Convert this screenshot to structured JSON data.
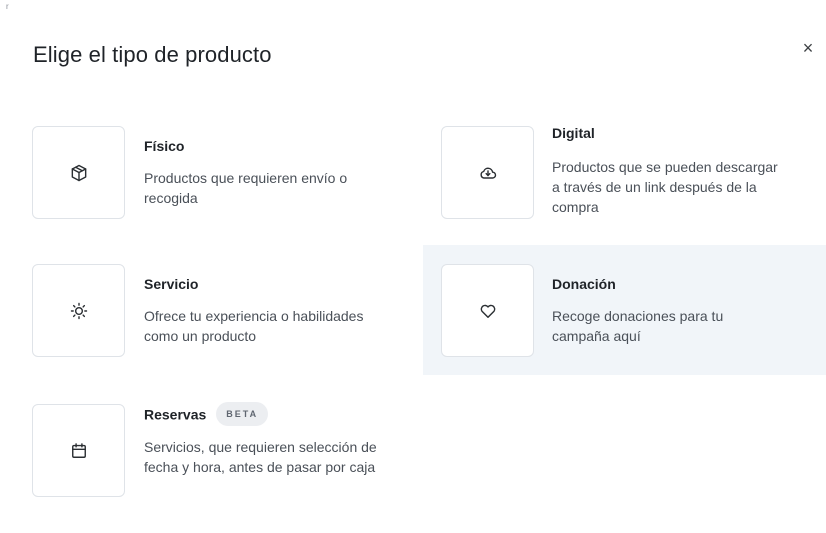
{
  "corner_mark": "r",
  "dialog": {
    "title": "Elige el tipo de producto",
    "close_label": "×"
  },
  "options": [
    {
      "id": "fisico",
      "title": "Físico",
      "description": "Productos que requieren envío o recogida",
      "icon": "box-icon"
    },
    {
      "id": "digital",
      "title": "Digital",
      "description": "Productos que se pueden descargar a través de un link después de la compra",
      "icon": "cloud-download-icon"
    },
    {
      "id": "servicio",
      "title": "Servicio",
      "description": "Ofrece tu experiencia o habilidades como un producto",
      "icon": "sun-icon"
    },
    {
      "id": "donacion",
      "title": "Donación",
      "description": "Recoge donaciones para tu campaña aquí",
      "icon": "heart-icon",
      "highlighted": true
    },
    {
      "id": "reservas",
      "title": "Reservas",
      "badge": "BETA",
      "description": "Servicios, que requieren selección de fecha y hora, antes de pasar por caja",
      "icon": "calendar-icon"
    }
  ],
  "colors": {
    "highlight_background": "#f1f5f9",
    "border": "#dfe3e8",
    "title_text": "#1f2328",
    "description_text": "#4a5058"
  }
}
